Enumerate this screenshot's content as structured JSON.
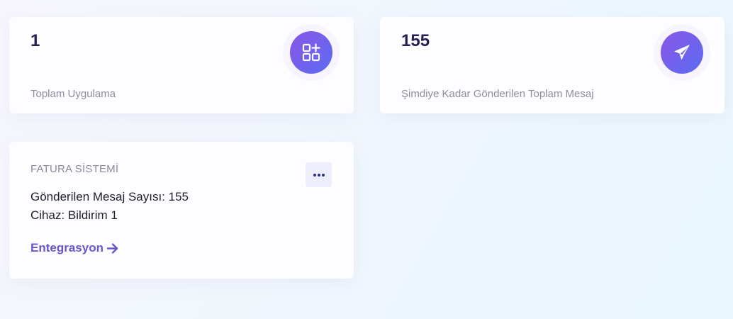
{
  "stats": {
    "apps": {
      "value": "1",
      "label": "Toplam Uygulama",
      "icon": "grid-plus-icon"
    },
    "messages": {
      "value": "155",
      "label": "Şimdiye Kadar Gönderilen Toplam Mesaj",
      "icon": "paper-plane-icon"
    }
  },
  "app_card": {
    "name": "FATURA SİSTEMİ",
    "more_icon": "more-horizontal-icon",
    "sent_count_text": "Gönderilen Mesaj Sayısı: 155",
    "device_text": "Cihaz: Bildirim 1",
    "link_label": "Entegrasyon",
    "link_icon": "arrow-right-icon"
  },
  "colors": {
    "accent_gradient_start": "#8a56e8",
    "accent_gradient_end": "#5b6cf0",
    "link": "#6657cf",
    "value_text": "#262152"
  }
}
